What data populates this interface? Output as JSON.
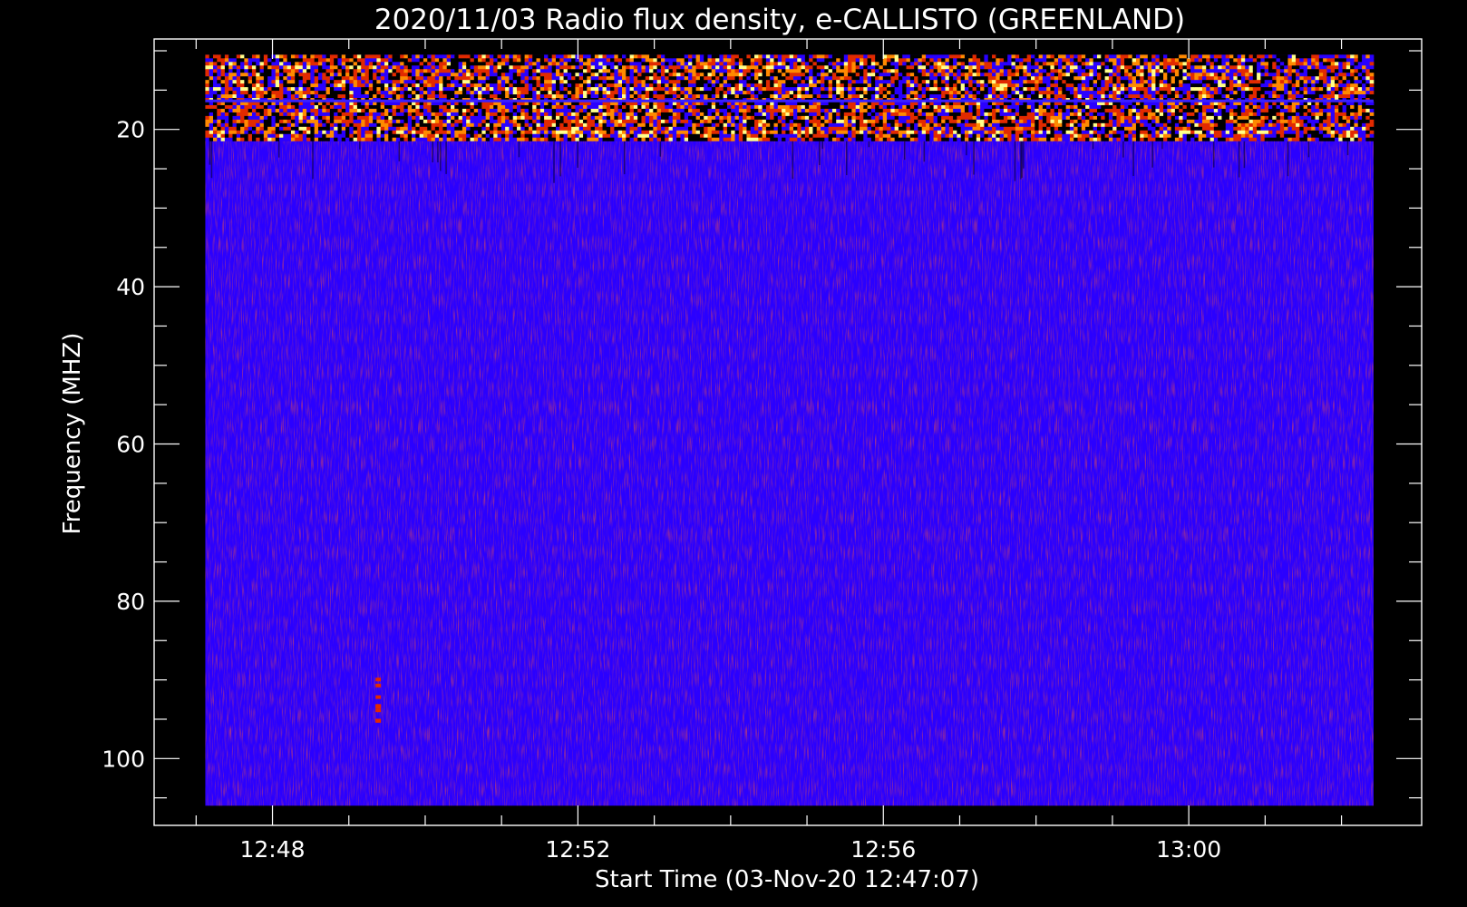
{
  "chart_data": {
    "type": "heatmap",
    "title": "2020/11/03  Radio flux density, e-CALLISTO (GREENLAND)",
    "xlabel": "Start Time (03-Nov-20 12:47:07)",
    "ylabel": "Frequency (MHZ)",
    "x_range_minutes_after_12h": [
      46.45,
      63.05
    ],
    "data_x_range_minutes_after_12h": [
      47.12,
      62.42
    ],
    "y_range_mhz": [
      8.5,
      108.5
    ],
    "data_y_range_mhz": [
      10.5,
      106.0
    ],
    "y_reversed": true,
    "x_ticks": [
      {
        "value": 48,
        "label": "12:48"
      },
      {
        "value": 52,
        "label": "12:52"
      },
      {
        "value": 56,
        "label": "12:56"
      },
      {
        "value": 60,
        "label": "13:00"
      }
    ],
    "y_ticks": [
      {
        "value": 20,
        "label": "20"
      },
      {
        "value": 40,
        "label": "40"
      },
      {
        "value": 60,
        "label": "60"
      },
      {
        "value": 80,
        "label": "80"
      },
      {
        "value": 100,
        "label": "100"
      }
    ],
    "background_color": "#000000",
    "colormap": [
      "#000000",
      "#2a00ff",
      "#e22a00",
      "#ff8a00",
      "#ffff8a"
    ],
    "features": [
      {
        "kind": "broadband interference band",
        "freq_mhz": [
          10.5,
          21.5
        ],
        "time_min_after_12h": [
          47.12,
          62.42
        ],
        "intensity": "high"
      },
      {
        "kind": "quiet background",
        "freq_mhz": [
          21.5,
          106.0
        ],
        "time_min_after_12h": [
          47.12,
          62.42
        ],
        "intensity": "low"
      },
      {
        "kind": "narrow red spike",
        "freq_mhz": [
          88,
          100
        ],
        "time_min_after_12h": [
          49.35,
          49.42
        ],
        "intensity": "medium"
      }
    ]
  }
}
